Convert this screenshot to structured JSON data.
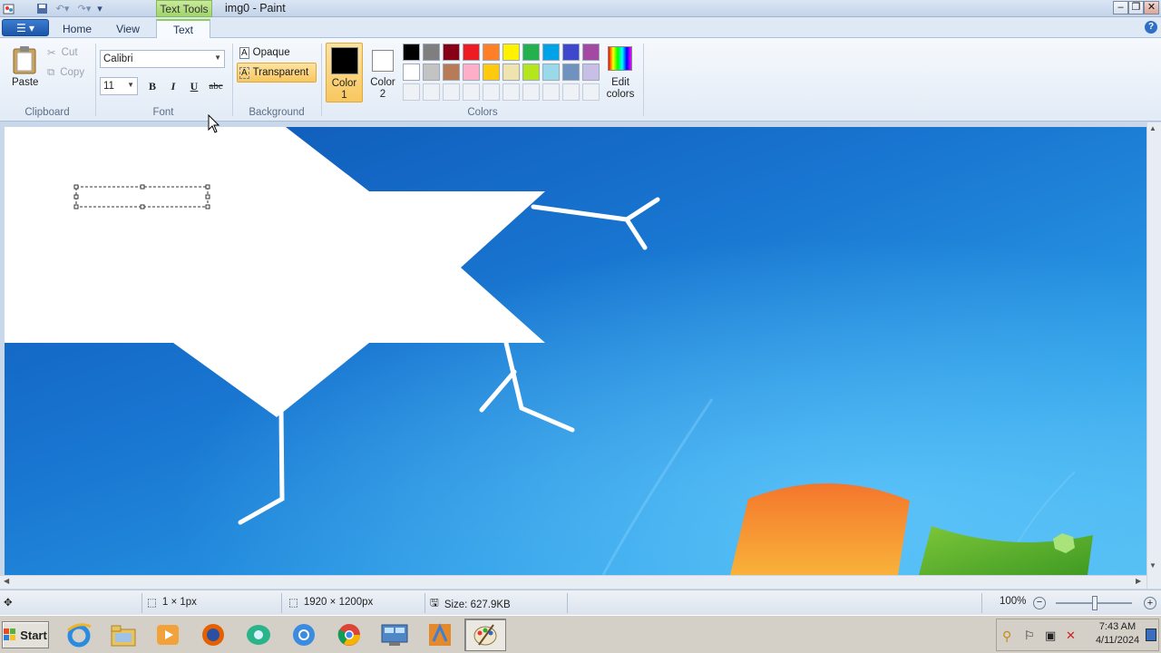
{
  "window": {
    "title": "img0 - Paint",
    "context_tab": "Text Tools",
    "buttons": {
      "minimize": "‒",
      "restore": "❐",
      "close": "✕"
    }
  },
  "tabs": {
    "file": "☰ ▾",
    "home": "Home",
    "view": "View",
    "text": "Text"
  },
  "clipboard": {
    "paste": "Paste",
    "cut": "Cut",
    "copy": "Copy",
    "group": "Clipboard"
  },
  "font": {
    "family": "Calibri",
    "size": "11",
    "bold": "B",
    "italic": "I",
    "underline": "U",
    "strike": "abc",
    "group": "Font"
  },
  "background": {
    "opaque": "Opaque",
    "transparent": "Transparent",
    "group": "Background"
  },
  "colors": {
    "color1_label": "Color\n1",
    "color1_a": "Color",
    "color1_b": "1",
    "color2_a": "Color",
    "color2_b": "2",
    "color1_value": "#000000",
    "color2_value": "#ffffff",
    "edit_a": "Edit",
    "edit_b": "colors",
    "group": "Colors",
    "palette_row1": [
      "#000000",
      "#7f7f7f",
      "#880015",
      "#ed1c24",
      "#ff7f27",
      "#fff200",
      "#22b14c",
      "#00a2e8",
      "#3f48cc",
      "#a349a4"
    ],
    "palette_row2": [
      "#ffffff",
      "#c3c3c3",
      "#b97a57",
      "#ffaec9",
      "#ffc90e",
      "#efe4b0",
      "#b5e61d",
      "#99d9ea",
      "#7092be",
      "#c8bfe7"
    ]
  },
  "status": {
    "cursor_pos": "",
    "selection_size": "1 × 1px",
    "image_size": "1920 × 1200px",
    "file_size": "Size: 627.9KB",
    "zoom": "100%"
  },
  "taskbar": {
    "start": "Start",
    "apps": [
      "internet-explorer",
      "file-explorer",
      "media-player",
      "firefox",
      "messenger",
      "chrome-blue",
      "chrome",
      "control-panel",
      "media-center",
      "paint"
    ],
    "clock_time": "7:43 AM",
    "clock_date": "4/11/2024"
  }
}
